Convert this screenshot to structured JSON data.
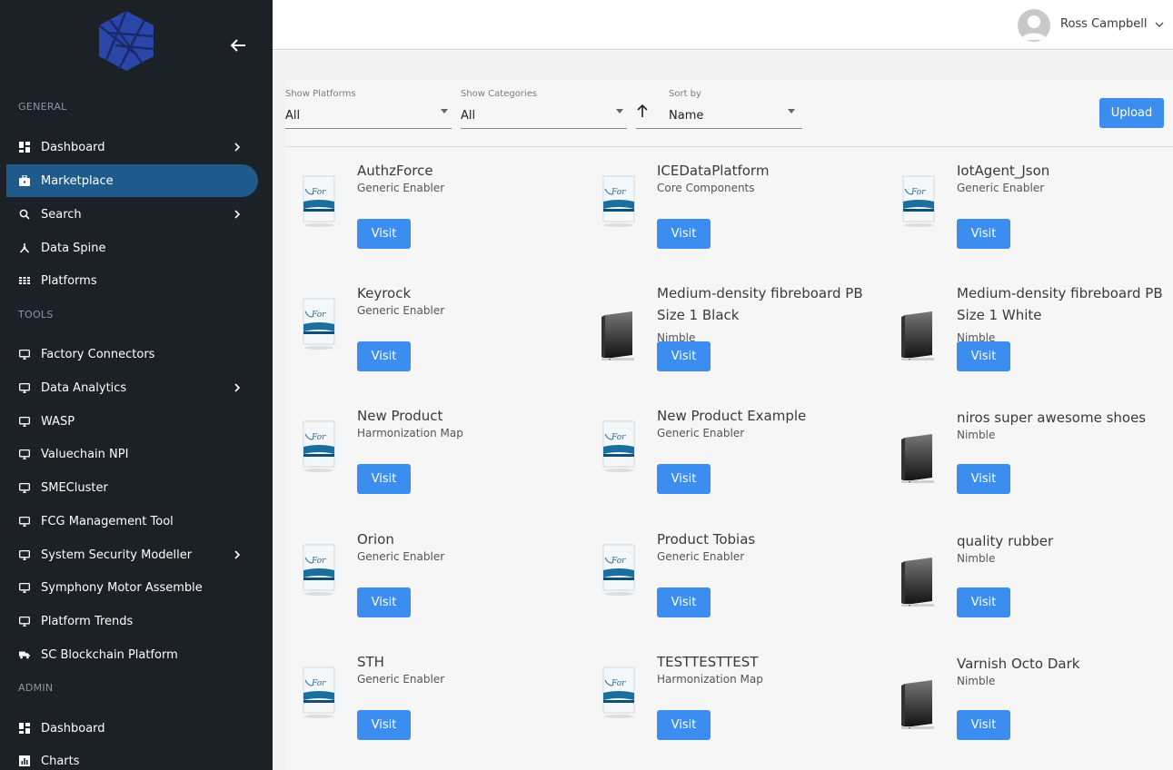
{
  "user": {
    "name": "Ross Campbell"
  },
  "sidebar": {
    "sections": [
      {
        "title": "GENERAL"
      },
      {
        "title": "TOOLS"
      },
      {
        "title": "ADMIN"
      }
    ],
    "items": [
      {
        "label": "Dashboard",
        "icon": "dashboard-icon"
      },
      {
        "label": "Marketplace",
        "icon": "briefcase-icon"
      },
      {
        "label": "Search",
        "icon": "search-icon"
      },
      {
        "label": "Data Spine",
        "icon": "hub-icon"
      },
      {
        "label": "Platforms",
        "icon": "grid-icon"
      },
      {
        "label": "Factory Connectors",
        "icon": "monitor-icon"
      },
      {
        "label": "Data Analytics",
        "icon": "monitor-icon"
      },
      {
        "label": "WASP",
        "icon": "monitor-icon"
      },
      {
        "label": "Valuechain NPI",
        "icon": "monitor-icon"
      },
      {
        "label": "SMECluster",
        "icon": "monitor-icon"
      },
      {
        "label": "FCG Management Tool",
        "icon": "monitor-icon"
      },
      {
        "label": "System Security Modeller",
        "icon": "monitor-icon"
      },
      {
        "label": "Symphony Motor Assemble",
        "icon": "monitor-icon"
      },
      {
        "label": "Platform Trends",
        "icon": "monitor-icon"
      },
      {
        "label": "SC Blockchain Platform",
        "icon": "truck-icon"
      },
      {
        "label": "Dashboard",
        "icon": "dashboard-icon"
      },
      {
        "label": "Charts",
        "icon": "chart-icon"
      }
    ]
  },
  "filters": {
    "platforms": {
      "label": "Show Platforms",
      "value": "All"
    },
    "categories": {
      "label": "Show Categories",
      "value": "All"
    },
    "sort": {
      "label": "Sort by",
      "value": "Name"
    },
    "upload_label": "Upload"
  },
  "products": [
    {
      "name": "AuthzForce",
      "category": "Generic Enabler",
      "image": "fiware-box"
    },
    {
      "name": "ICEDataPlatform",
      "category": "Core Components",
      "image": "fiware-box"
    },
    {
      "name": "IotAgent_Json",
      "category": "Generic Enabler",
      "image": "fiware-box"
    },
    {
      "name": "Keyrock",
      "category": "Generic Enabler",
      "image": "fiware-box"
    },
    {
      "name": "Medium-density fibreboard PB Size 1 Black",
      "category": "Nimble",
      "image": "panel-box"
    },
    {
      "name": "Medium-density fibreboard PB Size 1 White",
      "category": "Nimble",
      "image": "panel-box"
    },
    {
      "name": "New Product",
      "category": "Harmonization Map",
      "image": "fiware-box"
    },
    {
      "name": "New Product Example",
      "category": "Generic Enabler",
      "image": "fiware-box"
    },
    {
      "name": "niros super awesome shoes",
      "category": "Nimble",
      "image": "panel-box"
    },
    {
      "name": "Orion",
      "category": "Generic Enabler",
      "image": "fiware-box"
    },
    {
      "name": "Product Tobias",
      "category": "Generic Enabler",
      "image": "fiware-box"
    },
    {
      "name": "quality rubber",
      "category": "Nimble",
      "image": "panel-box"
    },
    {
      "name": "STH",
      "category": "Generic Enabler",
      "image": "fiware-box"
    },
    {
      "name": "TESTTESTTEST",
      "category": "Harmonization Map",
      "image": "fiware-box"
    },
    {
      "name": "Varnish Octo Dark",
      "category": "Nimble",
      "image": "panel-box"
    }
  ],
  "visit_label": "Visit",
  "colors": {
    "sidebar": "#1c2127",
    "active": "#1e5b8c",
    "primary": "#3b8ef0"
  }
}
